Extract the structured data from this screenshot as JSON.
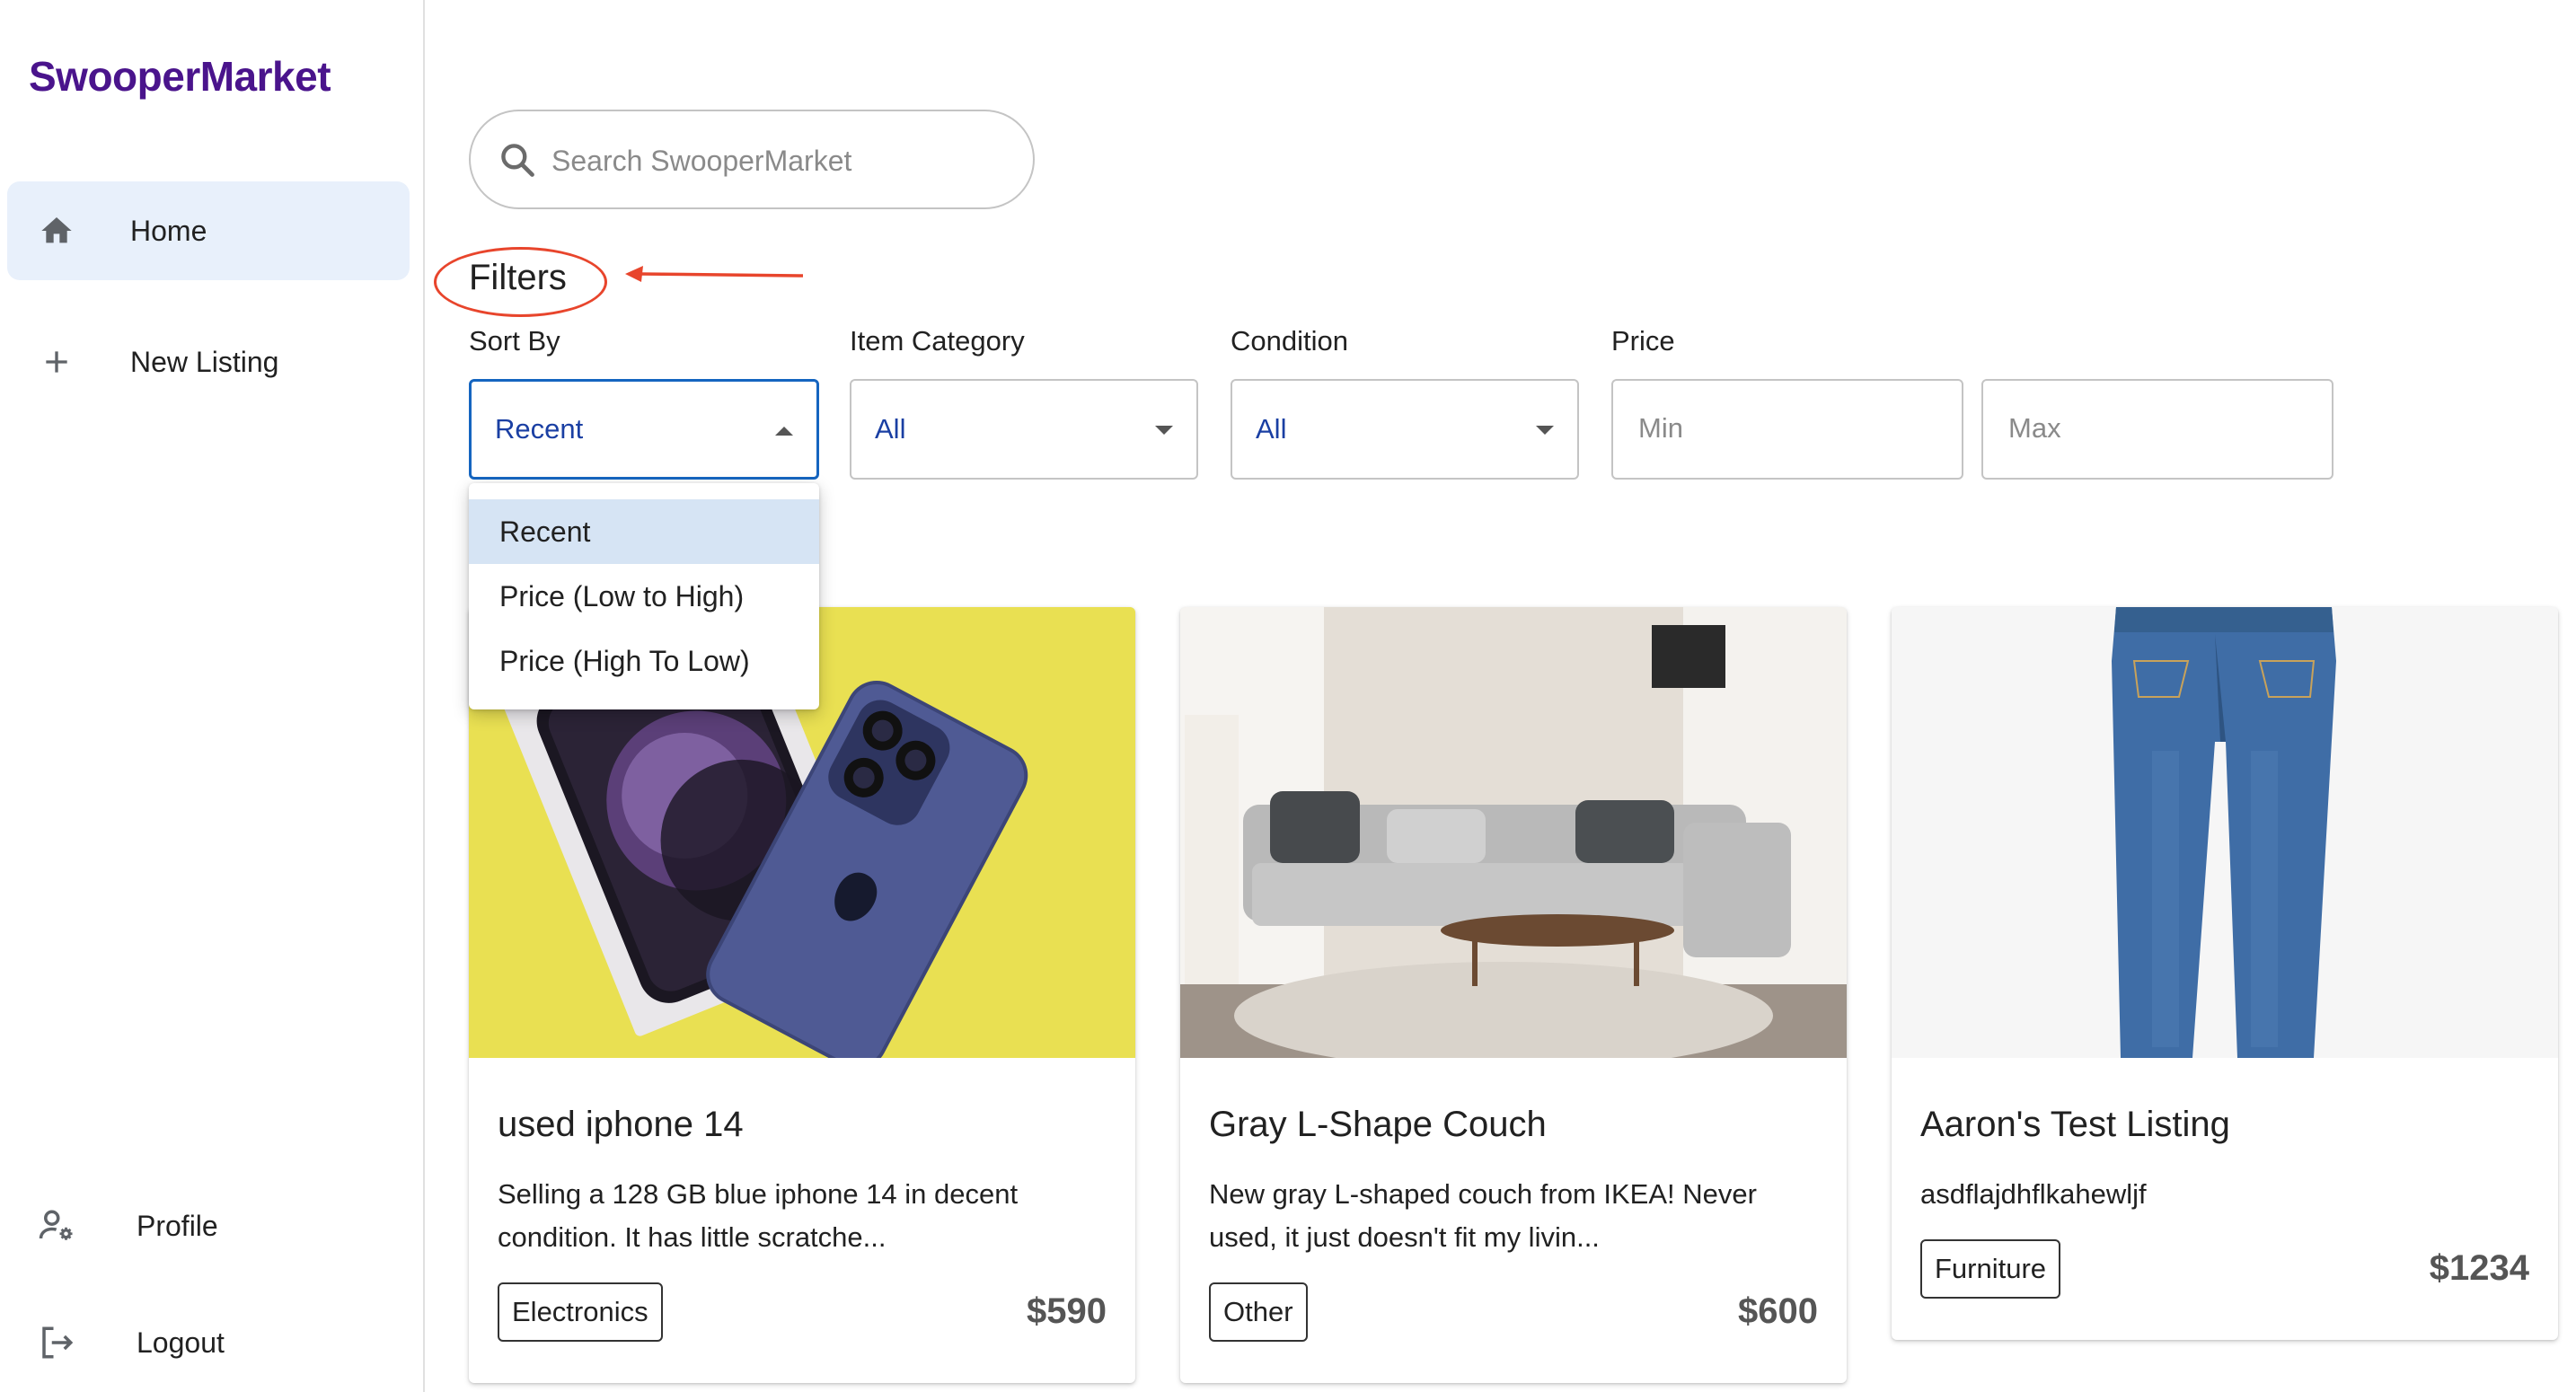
{
  "app": {
    "brand": "SwooperMarket"
  },
  "sidebar": {
    "items": [
      {
        "label": "Home",
        "icon": "home-icon",
        "active": true
      },
      {
        "label": "New Listing",
        "icon": "plus-icon"
      },
      {
        "label": "Profile",
        "icon": "user-settings-icon"
      },
      {
        "label": "Logout",
        "icon": "logout-icon"
      }
    ]
  },
  "search": {
    "placeholder": "Search SwooperMarket",
    "value": ""
  },
  "filters": {
    "title": "Filters",
    "sort_by": {
      "label": "Sort By",
      "value": "Recent",
      "options": [
        "Recent",
        "Price (Low to High)",
        "Price (High To Low)"
      ],
      "selected_option": "Recent",
      "open": true
    },
    "category": {
      "label": "Item Category",
      "value": "All"
    },
    "condition": {
      "label": "Condition",
      "value": "All"
    },
    "price": {
      "label": "Price",
      "min_placeholder": "Min",
      "max_placeholder": "Max"
    }
  },
  "listings": [
    {
      "title": "used iphone 14",
      "description": "Selling a 128 GB blue iphone 14 in decent condition. It has little scratche...",
      "category": "Electronics",
      "price": "$590"
    },
    {
      "title": "Gray L-Shape Couch",
      "description": "New gray L-shaped couch from IKEA! Never used, it just doesn't fit my livin...",
      "category": "Other",
      "price": "$600"
    },
    {
      "title": "Aaron's Test Listing",
      "description": "asdflajdhflkahewljf",
      "category": "Furniture",
      "price": "$1234"
    }
  ],
  "colors": {
    "brand": "#4a148c",
    "accent": "#1565c0",
    "annotation": "#e8452c",
    "active_nav": "#e8f0fb"
  }
}
